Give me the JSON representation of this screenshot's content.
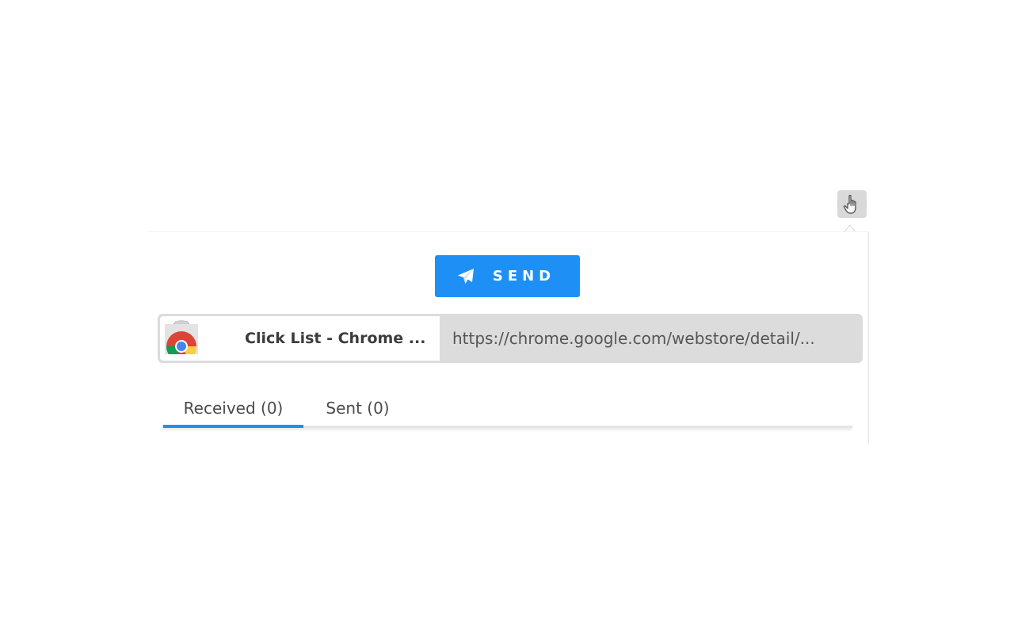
{
  "extension": {
    "icon": "hand-pointer-icon"
  },
  "popup": {
    "send_button": {
      "label": "SEND",
      "icon": "paper-plane-icon",
      "color": "#1e90f5"
    },
    "link_card": {
      "favicon": "chrome-web-store-icon",
      "title": "Click List - Chrome ...",
      "url": "https://chrome.google.com/webstore/detail/..."
    },
    "tabs": [
      {
        "label": "Received (0)",
        "active": true
      },
      {
        "label": "Sent (0)",
        "active": false
      }
    ],
    "accent_color": "#1e90f5"
  }
}
